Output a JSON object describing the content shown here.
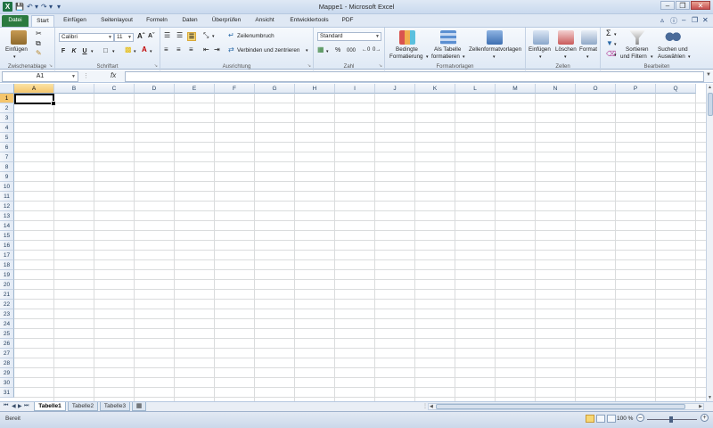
{
  "window": {
    "title": "Mappe1 - Microsoft Excel",
    "app_letter": "X"
  },
  "tabs": [
    {
      "label": "Datei"
    },
    {
      "label": "Start"
    },
    {
      "label": "Einfügen"
    },
    {
      "label": "Seitenlayout"
    },
    {
      "label": "Formeln"
    },
    {
      "label": "Daten"
    },
    {
      "label": "Überprüfen"
    },
    {
      "label": "Ansicht"
    },
    {
      "label": "Entwicklertools"
    },
    {
      "label": "PDF"
    }
  ],
  "active_tab": "Start",
  "ribbon": {
    "clipboard": {
      "label": "Zwischenablage",
      "paste": "Einfügen"
    },
    "font": {
      "label": "Schriftart",
      "font_name": "Calibri",
      "font_size": "11"
    },
    "alignment": {
      "label": "Ausrichtung",
      "wrap": "Zeilenumbruch",
      "merge": "Verbinden und zentrieren"
    },
    "number": {
      "label": "Zahl",
      "format": "Standard",
      "percent": "%",
      "thousands": "000"
    },
    "styles": {
      "label": "Formatvorlagen",
      "conditional_1": "Bedingte",
      "conditional_2": "Formatierung",
      "table_1": "Als Tabelle",
      "table_2": "formatieren",
      "cellstyles": "Zellenformatvorlagen"
    },
    "cells": {
      "label": "Zellen",
      "insert": "Einfügen",
      "delete": "Löschen",
      "format": "Format"
    },
    "editing": {
      "label": "Bearbeiten",
      "sort_1": "Sortieren",
      "sort_2": "und Filtern",
      "find_1": "Suchen und",
      "find_2": "Auswählen"
    }
  },
  "formula_bar": {
    "name_box": "A1",
    "fx": "fx",
    "value": ""
  },
  "grid": {
    "columns": [
      "A",
      "B",
      "C",
      "D",
      "E",
      "F",
      "G",
      "H",
      "I",
      "J",
      "K",
      "L",
      "M",
      "N",
      "O",
      "P",
      "Q"
    ],
    "rows": [
      "1",
      "2",
      "3",
      "4",
      "5",
      "6",
      "7",
      "8",
      "9",
      "10",
      "11",
      "12",
      "13",
      "14",
      "15",
      "16",
      "17",
      "18",
      "19",
      "20",
      "21",
      "22",
      "23",
      "24",
      "25",
      "26",
      "27",
      "28",
      "29",
      "30",
      "31"
    ],
    "active_cell": "A1"
  },
  "sheets": [
    {
      "label": "Tabelle1",
      "active": true
    },
    {
      "label": "Tabelle2",
      "active": false
    },
    {
      "label": "Tabelle3",
      "active": false
    }
  ],
  "status": {
    "ready": "Bereit",
    "zoom": "100 %"
  },
  "colors": {
    "file_tab": "#2b7a3f",
    "selection": "#f5c56b",
    "grid_line": "#dadcdd"
  }
}
